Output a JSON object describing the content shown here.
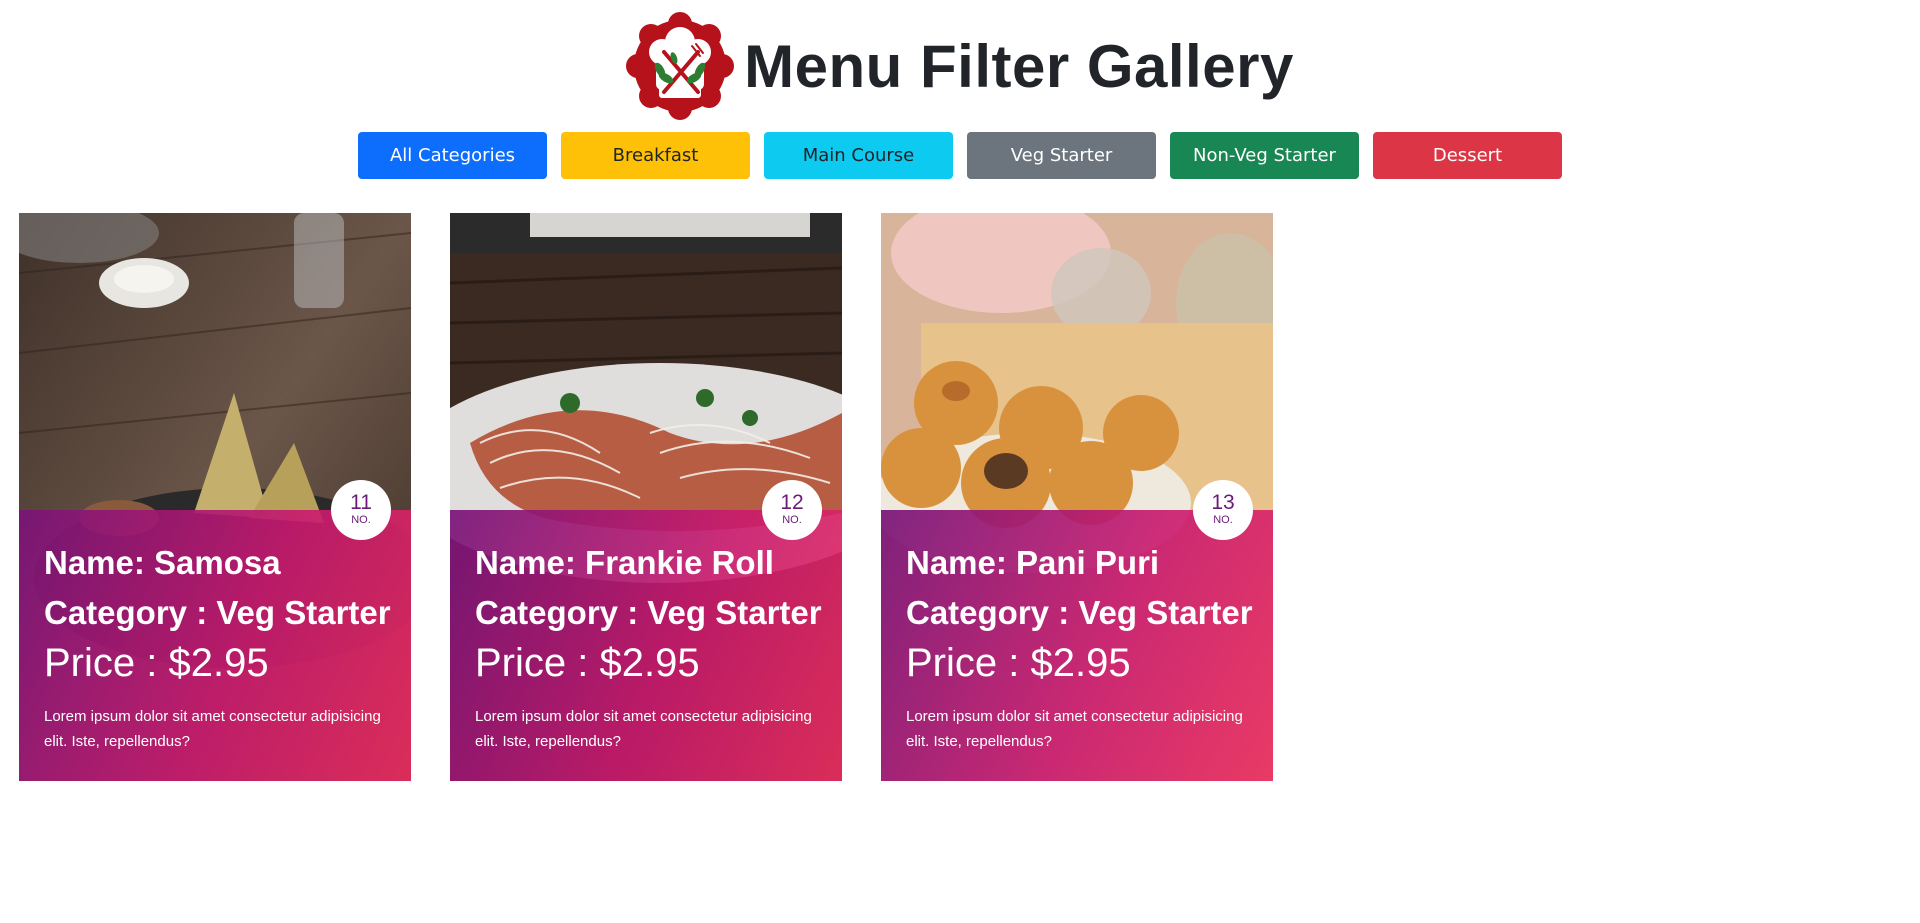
{
  "header": {
    "title": "Menu Filter Gallery",
    "logo_icon": "restaurant-logo-icon",
    "logo_color": "#b5121b"
  },
  "filters": [
    {
      "label": "All Categories",
      "color": "#0d6efd"
    },
    {
      "label": "Breakfast",
      "color": "#ffc107"
    },
    {
      "label": "Main Course",
      "color": "#0dcaf0"
    },
    {
      "label": "Veg Starter",
      "color": "#6c757d"
    },
    {
      "label": "Non-Veg Starter",
      "color": "#198754"
    },
    {
      "label": "Dessert",
      "color": "#dc3545"
    }
  ],
  "cards": [
    {
      "number": "11",
      "number_label": "NO.",
      "name": "Name: Samosa",
      "category": "Category : Veg Starter",
      "price": "Price : $2.95",
      "description": "Lorem ipsum dolor sit amet consectetur adipisicing elit. Iste, repellendus?",
      "photo": "samosa-photo"
    },
    {
      "number": "12",
      "number_label": "NO.",
      "name": "Name: Frankie Roll",
      "category": "Category : Veg Starter",
      "price": "Price : $2.95",
      "description": "Lorem ipsum dolor sit amet consectetur adipisicing elit. Iste, repellendus?",
      "photo": "frankie-roll-photo"
    },
    {
      "number": "13",
      "number_label": "NO.",
      "name": "Name: Pani Puri",
      "category": "Category : Veg Starter",
      "price": "Price : $2.95",
      "description": "Lorem ipsum dolor sit amet consectetur adipisicing elit. Iste, repellendus?",
      "photo": "pani-puri-photo"
    }
  ]
}
